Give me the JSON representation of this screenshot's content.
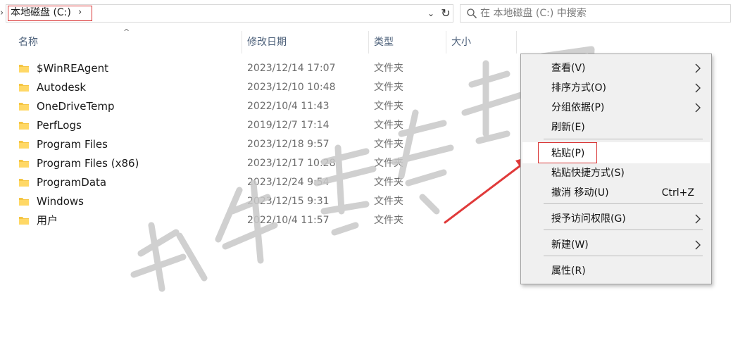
{
  "address_bar": {
    "breadcrumb": "本地磁盘 (C:)",
    "crumb_chevron": "›",
    "dropdown_glyph": "⌄",
    "refresh_glyph": "↻"
  },
  "search": {
    "placeholder": "在 本地磁盘 (C:) 中搜索"
  },
  "columns": [
    {
      "label": "名称"
    },
    {
      "label": "修改日期"
    },
    {
      "label": "类型"
    },
    {
      "label": "大小"
    }
  ],
  "files": [
    {
      "name": "$WinREAgent",
      "date": "2023/12/14 17:07",
      "type": "文件夹"
    },
    {
      "name": "Autodesk",
      "date": "2023/12/10 10:48",
      "type": "文件夹"
    },
    {
      "name": "OneDriveTemp",
      "date": "2022/10/4 11:43",
      "type": "文件夹"
    },
    {
      "name": "PerfLogs",
      "date": "2019/12/7 17:14",
      "type": "文件夹"
    },
    {
      "name": "Program Files",
      "date": "2023/12/18 9:57",
      "type": "文件夹"
    },
    {
      "name": "Program Files (x86)",
      "date": "2023/12/17 10:28",
      "type": "文件夹"
    },
    {
      "name": "ProgramData",
      "date": "2023/12/24 9:54",
      "type": "文件夹"
    },
    {
      "name": "Windows",
      "date": "2023/12/15 9:31",
      "type": "文件夹"
    },
    {
      "name": "用户",
      "date": "2022/10/4 11:57",
      "type": "文件夹"
    }
  ],
  "context_menu": {
    "items": [
      {
        "label": "查看(V)",
        "submenu": true
      },
      {
        "label": "排序方式(O)",
        "submenu": true
      },
      {
        "label": "分组依据(P)",
        "submenu": true
      },
      {
        "label": "刷新(E)"
      },
      {
        "label": "粘贴(P)"
      },
      {
        "label": "粘贴快捷方式(S)"
      },
      {
        "label": "撤消 移动(U)",
        "shortcut": "Ctrl+Z"
      },
      {
        "label": "授予访问权限(G)",
        "submenu": true
      },
      {
        "label": "新建(W)",
        "submenu": true
      },
      {
        "label": "属性(R)"
      }
    ]
  },
  "colors": {
    "header_text": "#4c607a",
    "folder_yellow": "#f5c542",
    "highlight_red": "#d93636",
    "menu_bg": "#f0f0f0",
    "watermark_gray": "#c8c8c8"
  },
  "icons": {
    "folder": "folder-icon",
    "search": "search-icon",
    "submenu": "chevron-right-icon",
    "refresh": "refresh-icon",
    "dropdown": "chevron-down-icon"
  }
}
